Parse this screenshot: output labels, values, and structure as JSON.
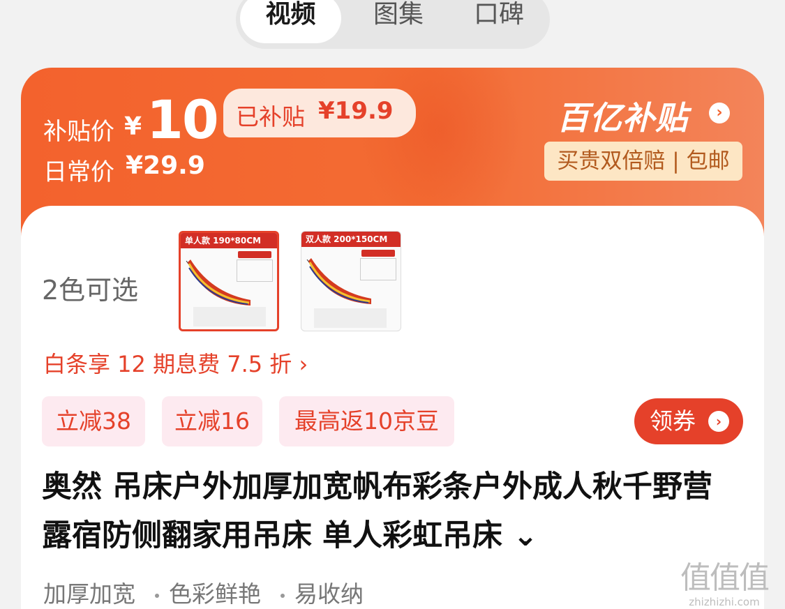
{
  "tabs": [
    {
      "label": "视频",
      "active": true
    },
    {
      "label": "图集",
      "active": false
    },
    {
      "label": "口碑",
      "active": false
    }
  ],
  "price": {
    "subsidy_label": "补贴价",
    "currency": "¥",
    "subsidy_price": "10",
    "daily_label": "日常价",
    "daily_price": "¥29.9",
    "subsidized_label": "已补贴",
    "subsidized_amount": "¥19.9",
    "brand": "百亿补贴",
    "promise": "买贵双倍赔 | 包邮",
    "colors": {
      "banner": "#f3622d",
      "accent": "#e5412a"
    }
  },
  "product": {
    "colors_label": "2色可选",
    "variants": [
      {
        "header": "单人款  190*80CM",
        "selected": true
      },
      {
        "header": "双人款  200*150CM",
        "selected": false
      }
    ],
    "baitiao": "白条享 12 期息费 7.5 折 ›",
    "coupons": [
      "立减38",
      "立减16",
      "最高返10京豆"
    ],
    "get_coupon": "领券",
    "title": "奥然 吊床户外加厚加宽帆布彩条户外成人秋千野营露宿防侧翻家用吊床 单人彩虹吊床 ⌄",
    "tags": [
      "加厚加宽",
      "色彩鲜艳",
      "易收纳"
    ]
  },
  "watermark": {
    "main": "值值值",
    "sub": "zhizhizhi.com"
  }
}
